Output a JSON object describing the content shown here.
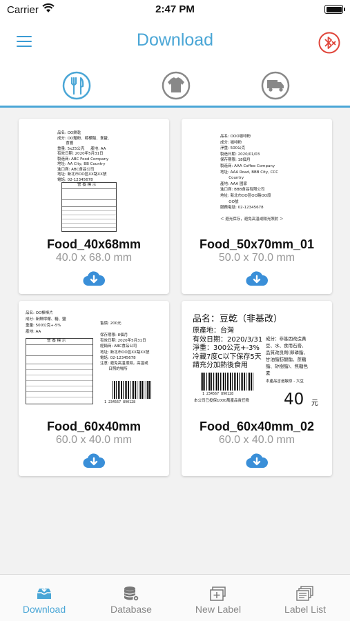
{
  "status_bar": {
    "carrier": "Carrier",
    "time": "2:47 PM"
  },
  "header": {
    "title": "Download",
    "menu_icon": "hamburger-menu-icon",
    "right_icon": "bluetooth-disconnected-icon"
  },
  "category_tabs": [
    {
      "icon": "food-utensils-icon",
      "selected": true
    },
    {
      "icon": "clothing-shirt-icon",
      "selected": false
    },
    {
      "icon": "logistics-truck-icon",
      "selected": false
    }
  ],
  "templates": [
    {
      "name": "Food_40x68mm",
      "size": "40.0 x 68.0 mm",
      "preview": {
        "lines": "品名: OO餅乾\n成分: OO麵粉、檸檬酸、食鹽、\n       食醬\n重量: 5x25公克     產地: AA\n有效日期: 2020年5月31日\n製造商: ABC Food Company\n地址: AA City, BB Country\n進口商: ABC食品公司\n地址: 新北市OO區XX路XX號\n電話: 02-12345678",
        "table_title": "營 養 標 示"
      }
    },
    {
      "name": "Food_50x70mm_01",
      "size": "50.0 x 70.0 mm",
      "preview": {
        "lines": "品名: OOO咖啡粉\n成分: 咖啡粉\n淨重: 500公克\n製造日期: 2020/01/03\n保存期限: 18個月\n製造商: AAA Coffee Company\n地址: AAA Road, BBB City, CCC\n       Country\n產地: AAA 國家\n進口商: BBB食品有限公司\n地址: 新北市OO區OO路OO段\n       OO號\n服務電話: 02-12345678\n\n＜ 避光保存，避免高溫或陽光照射 ＞"
      }
    },
    {
      "name": "Food_60x40mm",
      "size": "60.0 x 40.0 mm",
      "preview": {
        "lines_left": "品名: OO棒棒片\n成分: 新鮮檸檬、糖、鹽\n重量: 500公克+-5%\n產地: AA",
        "table_title": "營 養 標 示",
        "price": "售價: 200元",
        "lines_right": "保存期限: 8個月\n有效日期: 2020年5月31日\n經銷商: ABC食品公司\n地址: 新北市OO區XX路XX號\n電話: 02-12345678\n注意: 避免高溫潮濕，高溫或\n       日照的場所",
        "barcode_number": "1 234567 890128"
      }
    },
    {
      "name": "Food_60x40mm_02",
      "size": "60.0 x 40.0 mm",
      "preview": {
        "title": "品名：豆乾（非基改）",
        "lines_left": "原產地：台灣\n有效日期：2020/3/31\n淨重：300公克+-3%\n冷藏7度C以下保存5天\n請充分加熱後食用",
        "lines_right": "成分：非基因改造黃\n豆、水、食用石膏、\n品質改良劑(卵磷脂、\n甘油脂肪酸酯、蔗糖\n脂、矽樹脂)、焦糖色\n素",
        "note": "本產品含過敏原 - 大豆",
        "barcode_number": "1 234567 890128",
        "footer": "本公司已投保1000萬產品責任險",
        "price": "40",
        "currency": "元"
      }
    }
  ],
  "bottom_nav": [
    {
      "label": "Download",
      "icon": "download-tray-icon",
      "active": true
    },
    {
      "label": "Database",
      "icon": "database-settings-icon",
      "active": false
    },
    {
      "label": "New Label",
      "icon": "new-label-icon",
      "active": false
    },
    {
      "label": "Label List",
      "icon": "label-list-icon",
      "active": false
    }
  ],
  "colors": {
    "accent": "#4aa6d6",
    "bluetooth_red": "#e0453a",
    "inactive": "#888888"
  }
}
